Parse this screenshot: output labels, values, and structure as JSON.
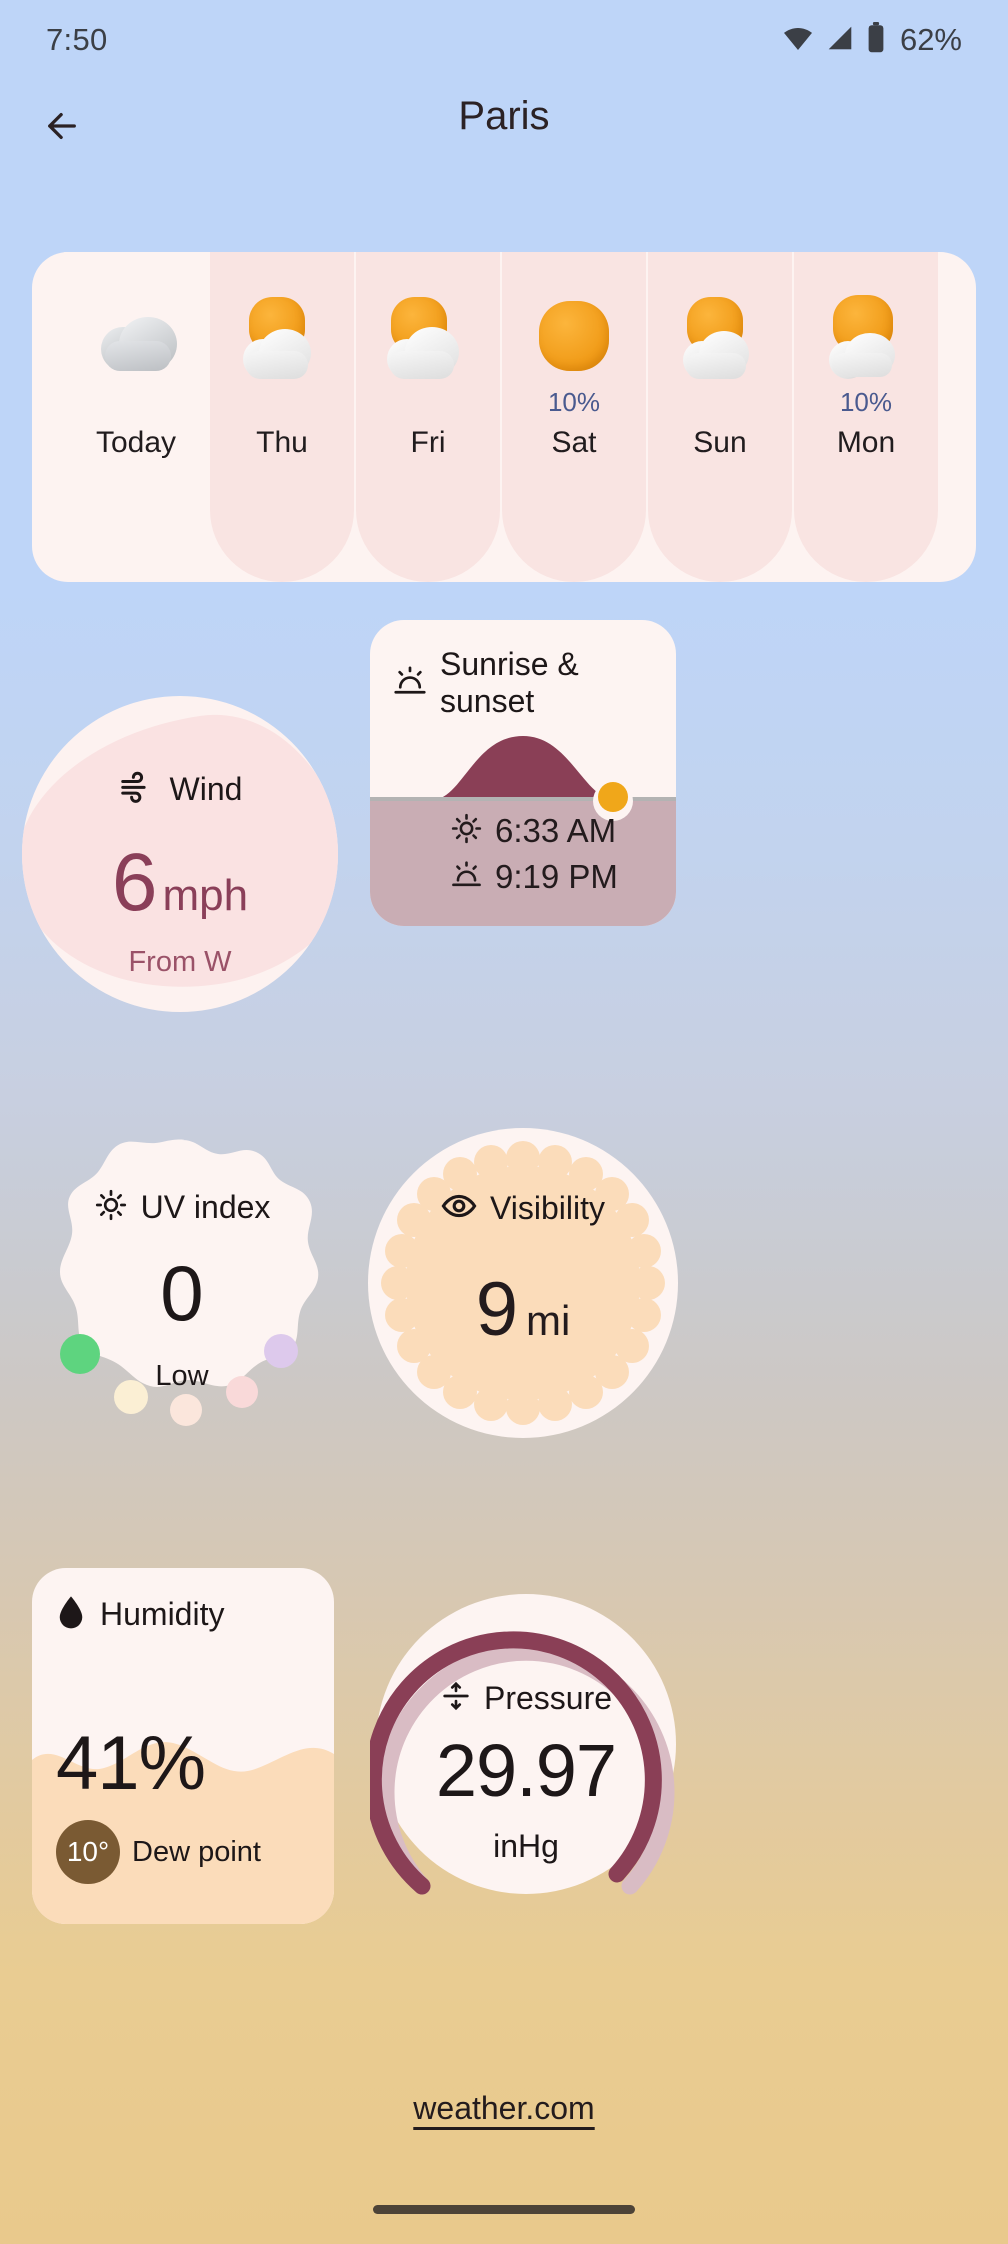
{
  "status_bar": {
    "time": "7:50",
    "battery_percent": "62%",
    "icons": [
      "wifi-icon",
      "cell-signal-icon",
      "battery-icon"
    ]
  },
  "header": {
    "back_label": "Back",
    "title": "Paris"
  },
  "forecast": {
    "days": [
      {
        "label": "Today",
        "icon": "cloudy-icon",
        "pop": ""
      },
      {
        "label": "Thu",
        "icon": "partly-cloudy-icon",
        "pop": ""
      },
      {
        "label": "Fri",
        "icon": "partly-cloudy-icon",
        "pop": ""
      },
      {
        "label": "Sat",
        "icon": "sunny-icon",
        "pop": "10%"
      },
      {
        "label": "Sun",
        "icon": "partly-cloudy-icon",
        "pop": ""
      },
      {
        "label": "Mon",
        "icon": "partly-cloudy-icon",
        "pop": "10%"
      }
    ],
    "pop_color": "#4a5a8f"
  },
  "wind": {
    "label": "Wind",
    "icon": "wind-icon",
    "value": "6",
    "unit": "mph",
    "direction": "From W",
    "accent": "#8a3f59"
  },
  "sun": {
    "label": "Sunrise & sunset",
    "icon": "sunrise-icon",
    "sunrise_icon": "sun-icon",
    "sunrise": "6:33 AM",
    "sunset_icon": "sunset-icon",
    "sunset": "9:19 PM",
    "arc_color": "#8a3f56",
    "ground_color": "#c9adb4"
  },
  "uv": {
    "label": "UV index",
    "icon": "sun-icon",
    "value": "0",
    "level": "Low",
    "dots": [
      "#5ed47f",
      "#ddc9ec",
      "#fbefd4",
      "#fbe6dc",
      "#f9d9d9"
    ]
  },
  "visibility": {
    "label": "Visibility",
    "icon": "eye-icon",
    "value": "9",
    "unit": "mi",
    "fill": "#fbdcba"
  },
  "humidity": {
    "label": "Humidity",
    "icon": "droplet-icon",
    "value": "41%",
    "dew_point_value": "10°",
    "dew_point_label": "Dew point",
    "fill": "#fbdcba",
    "badge_color": "#7a5a33"
  },
  "pressure": {
    "label": "Pressure",
    "icon": "pressure-icon",
    "value": "29.97",
    "unit": "inHg",
    "arc_color": "#8a3f56",
    "track_color": "#d9bcc4"
  },
  "footer": {
    "attribution": "weather.com"
  }
}
